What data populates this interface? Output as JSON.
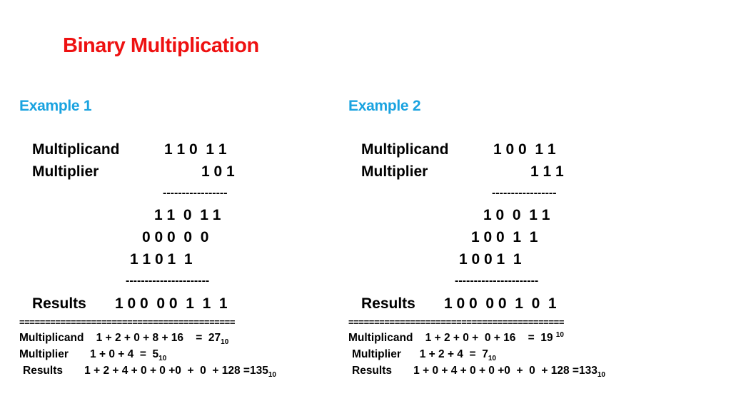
{
  "title": "Binary Multiplication",
  "examples": [
    {
      "heading": "Example 1",
      "multiplicand_label": "Multiplicand",
      "multiplicand_value": "1 1 0  1 1",
      "multiplier_label": "Multiplier",
      "multiplier_value": "1 0 1",
      "rule_short": "-----------------",
      "partials": [
        "1 1  0  1 1",
        "0 0 0  0  0",
        "1 1 0 1  1"
      ],
      "rule_long": "----------------------",
      "results_label": "Results",
      "results_value": "1 0 0  0 0  1  1  1",
      "separator": "==========================================",
      "decimal": {
        "multiplicand_label": "Multiplicand",
        "multiplicand_expr": "1 + 2 + 0 + 8 + 16    =  27",
        "multiplicand_base": "10",
        "multiplier_label": "Multiplier",
        "multiplier_expr": "1 + 0 + 4  =  5",
        "multiplier_base": "10",
        "results_label": "Results",
        "results_expr": "1 + 2 + 4 + 0 + 0 +0  +  0  + 128 =135",
        "results_base": "10"
      }
    },
    {
      "heading": "Example 2",
      "multiplicand_label": "Multiplicand",
      "multiplicand_value": "1 0 0  1 1",
      "multiplier_label": "Multiplier",
      "multiplier_value": "1 1 1",
      "rule_short": "-----------------",
      "partials": [
        "1 0  0  1 1",
        "1 0 0  1  1",
        "1 0 0 1  1"
      ],
      "rule_long": "----------------------",
      "results_label": "Results",
      "results_value": "1 0 0  0 0  1  0  1",
      "separator": "==========================================",
      "decimal": {
        "multiplicand_label": "Multiplicand",
        "multiplicand_expr": "1 + 2 + 0 +  0 + 16    =  19 ",
        "multiplicand_base": "10",
        "multiplier_label": "Multiplier",
        "multiplier_expr": "1 + 2 + 4  =  7",
        "multiplier_base": "10",
        "results_label": "Results",
        "results_expr": "1 + 0 + 4 + 0 + 0 +0  +  0  + 128 =133",
        "results_base": "10"
      }
    }
  ]
}
